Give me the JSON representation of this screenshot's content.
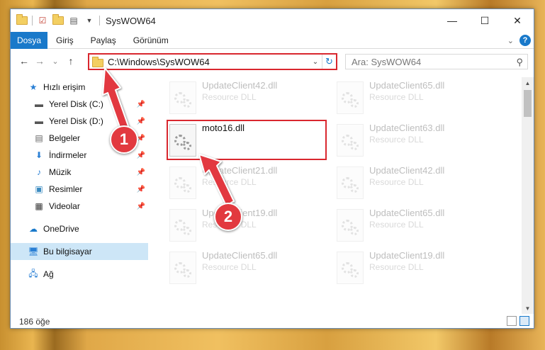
{
  "window": {
    "title": "SysWOW64",
    "controls": {
      "minimize": "—",
      "maximize": "☐",
      "close": "✕"
    }
  },
  "ribbon": {
    "tabs": [
      "Dosya",
      "Giriş",
      "Paylaş",
      "Görünüm"
    ],
    "active_tab": "Dosya"
  },
  "navbar": {
    "back": "←",
    "forward": "→",
    "recent": "⌄",
    "up": "↑",
    "address": "C:\\Windows\\SysWOW64",
    "search_placeholder": "Ara: SysWOW64"
  },
  "sidebar": {
    "items": [
      {
        "label": "Hızlı erişim",
        "icon": "star-icon",
        "pinned": false
      },
      {
        "label": "Yerel Disk (C:)",
        "icon": "drive-icon",
        "pinned": true
      },
      {
        "label": "Yerel Disk (D:)",
        "icon": "drive-icon",
        "pinned": true
      },
      {
        "label": "Belgeler",
        "icon": "document-icon",
        "pinned": true
      },
      {
        "label": "İndirmeler",
        "icon": "download-icon",
        "pinned": true
      },
      {
        "label": "Müzik",
        "icon": "music-icon",
        "pinned": true
      },
      {
        "label": "Resimler",
        "icon": "pictures-icon",
        "pinned": true
      },
      {
        "label": "Videolar",
        "icon": "video-icon",
        "pinned": true
      },
      {
        "label": "OneDrive",
        "icon": "cloud-icon",
        "pinned": false
      },
      {
        "label": "Bu bilgisayar",
        "icon": "computer-icon",
        "pinned": false,
        "selected": true
      },
      {
        "label": "Ağ",
        "icon": "network-icon",
        "pinned": false
      }
    ]
  },
  "files": [
    {
      "name": "UpdateClient42.dll",
      "type": "Resource DLL",
      "faded": true
    },
    {
      "name": "UpdateClient65.dll",
      "type": "Resource DLL",
      "faded": true
    },
    {
      "name": "moto16.dll",
      "type": "",
      "faded": false
    },
    {
      "name": "UpdateClient63.dll",
      "type": "Resource DLL",
      "faded": true
    },
    {
      "name": "UpdateClient21.dll",
      "type": "Resource DLL",
      "faded": true
    },
    {
      "name": "UpdateClient42.dll",
      "type": "Resource DLL",
      "faded": true
    },
    {
      "name": "UpdateClient19.dll",
      "type": "Resource DLL",
      "faded": true
    },
    {
      "name": "UpdateClient65.dll",
      "type": "Resource DLL",
      "faded": true
    },
    {
      "name": "UpdateClient65.dll",
      "type": "Resource DLL",
      "faded": true
    },
    {
      "name": "UpdateClient19.dll",
      "type": "Resource DLL",
      "faded": true
    }
  ],
  "status": {
    "item_count": "186 öğe"
  },
  "annotations": {
    "step1": "1",
    "step2": "2",
    "accent": "#d9272e"
  }
}
